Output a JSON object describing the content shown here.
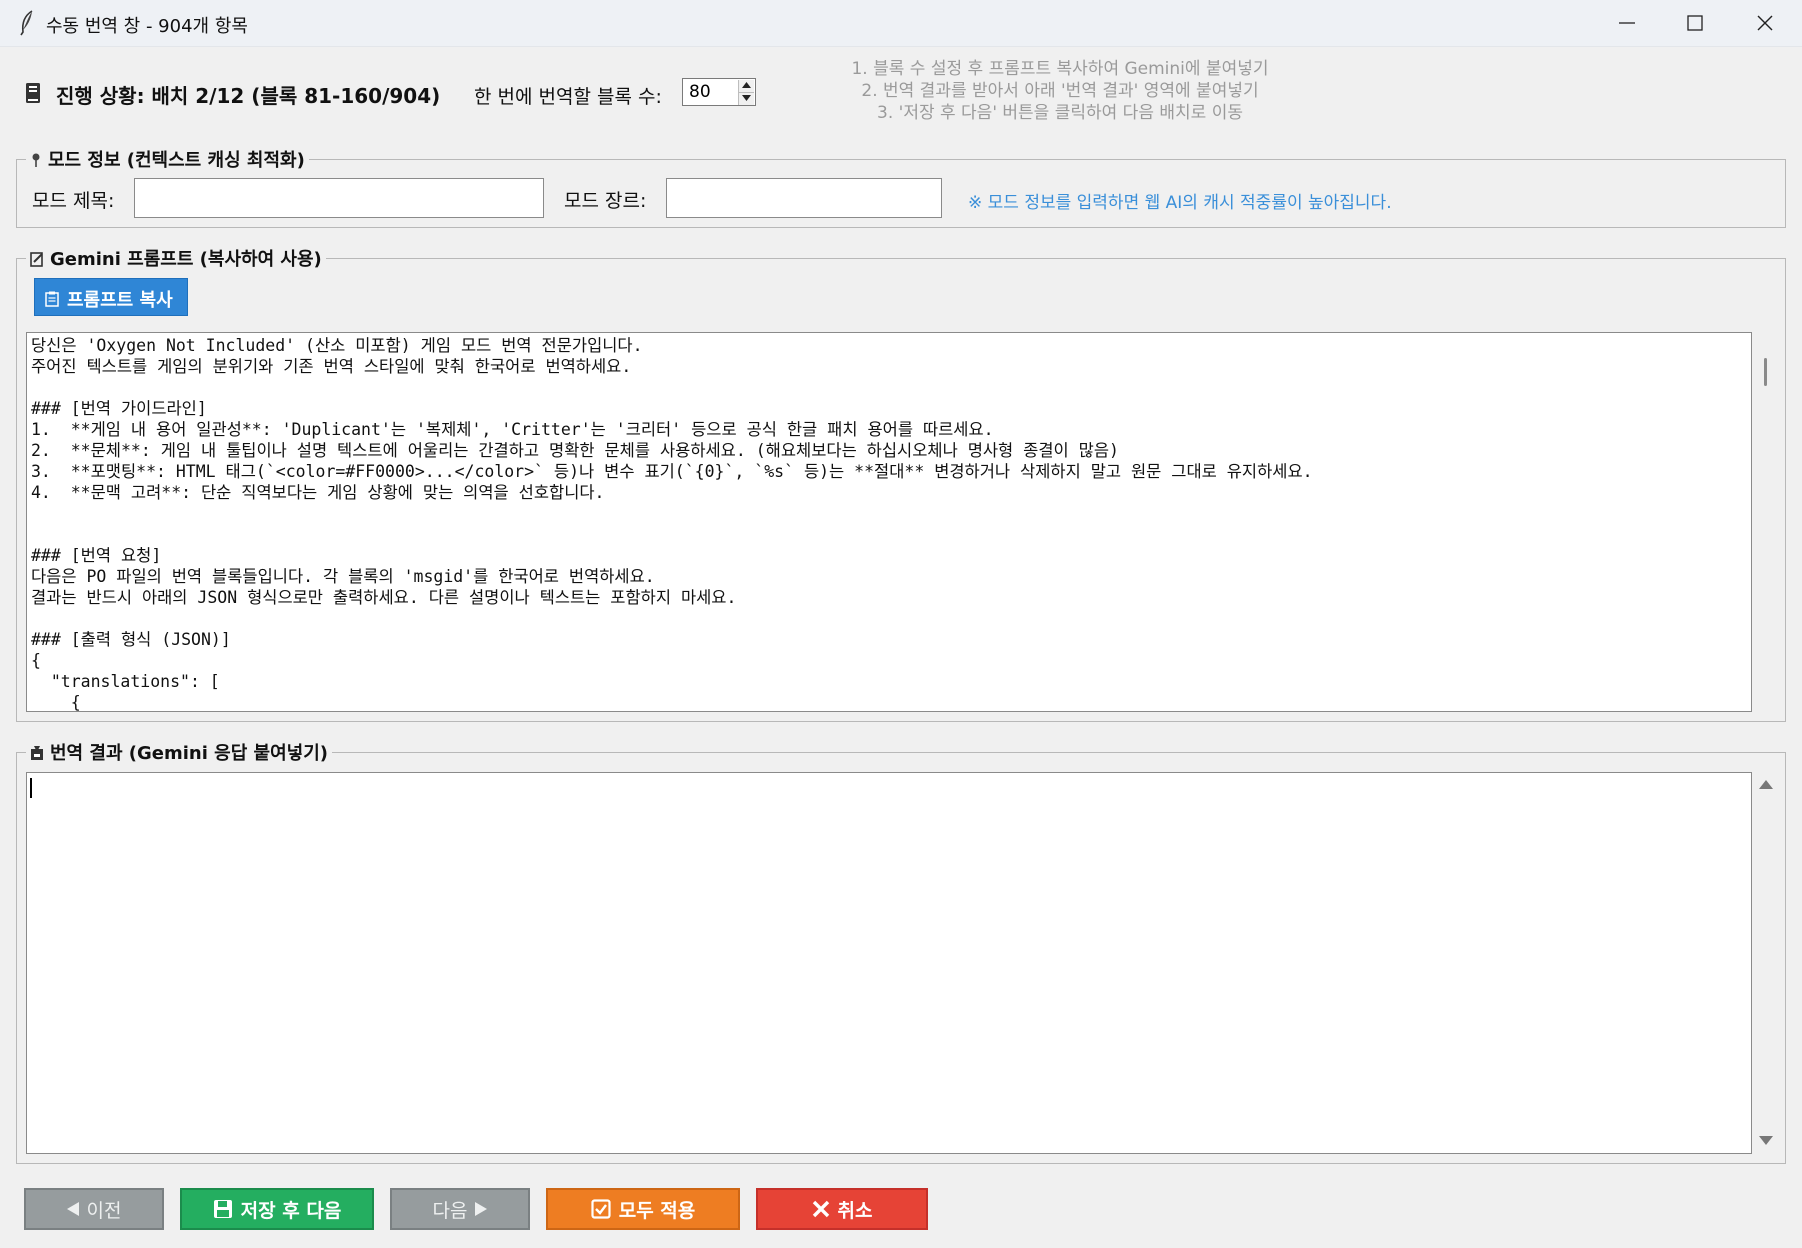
{
  "window": {
    "title": "수동 번역 창 - 904개 항목"
  },
  "progress": {
    "text": "진행 상황: 배치 2/12 (블록 81-160/904)",
    "blocks_label": "한 번에 번역할 블록 수:",
    "blocks_value": "80"
  },
  "instructions": [
    "1. 블록 수 설정 후 프롬프트 복사하여 Gemini에 붙여넣기",
    "2. 번역 결과를 받아서 아래 '번역 결과' 영역에 붙여넣기",
    "3. '저장 후 다음' 버튼을 클릭하여 다음 배치로 이동"
  ],
  "mod_info": {
    "legend": "모드 정보 (컨텍스트 캐싱 최적화)",
    "title_label": "모드 제목:",
    "title_value": "",
    "genre_label": "모드 장르:",
    "genre_value": "",
    "hint": "※ 모드 정보를 입력하면 웹 AI의 캐시 적중률이 높아집니다."
  },
  "prompt_section": {
    "legend": "Gemini 프롬프트 (복사하여 사용)",
    "copy_button": "프롬프트 복사",
    "text": "당신은 'Oxygen Not Included' (산소 미포함) 게임 모드 번역 전문가입니다.\n주어진 텍스트를 게임의 분위기와 기존 번역 스타일에 맞춰 한국어로 번역하세요.\n\n### [번역 가이드라인]\n1.  **게임 내 용어 일관성**: 'Duplicant'는 '복제체', 'Critter'는 '크리터' 등으로 공식 한글 패치 용어를 따르세요.\n2.  **문체**: 게임 내 툴팁이나 설명 텍스트에 어울리는 간결하고 명확한 문체를 사용하세요. (해요체보다는 하십시오체나 명사형 종결이 많음)\n3.  **포맷팅**: HTML 태그(`<color=#FF0000>...</color>` 등)나 변수 표기(`{0}`, `%s` 등)는 **절대** 변경하거나 삭제하지 말고 원문 그대로 유지하세요.\n4.  **문맥 고려**: 단순 직역보다는 게임 상황에 맞는 의역을 선호합니다.\n\n\n### [번역 요청]\n다음은 PO 파일의 번역 블록들입니다. 각 블록의 'msgid'를 한국어로 번역하세요.\n결과는 반드시 아래의 JSON 형식으로만 출력하세요. 다른 설명이나 텍스트는 포함하지 마세요.\n\n### [출력 형식 (JSON)]\n{\n  \"translations\": [\n    {"
  },
  "result_section": {
    "legend": "번역 결과 (Gemini 응답 붙여넣기)",
    "value": ""
  },
  "buttons": {
    "prev": "이전",
    "save_next": "저장 후 다음",
    "next": "다음",
    "apply_all": "모두 적용",
    "cancel": "취소"
  },
  "colors": {
    "accent_blue": "#2f86d6",
    "hint_blue": "#3a8fd9",
    "save_green": "#24ae60",
    "apply_orange": "#ee7d22",
    "cancel_red": "#e64336",
    "nav_gray": "#969c9e"
  },
  "icons": {
    "app": "feather-icon",
    "progress": "book-icon",
    "mod_info": "pin-icon",
    "prompt": "memo-icon",
    "copy": "clipboard-icon",
    "result": "inbox-icon",
    "prev": "triangle-left-icon",
    "save": "floppy-disk-icon",
    "next": "triangle-right-icon",
    "apply": "checkbox-icon",
    "cancel": "x-icon"
  }
}
